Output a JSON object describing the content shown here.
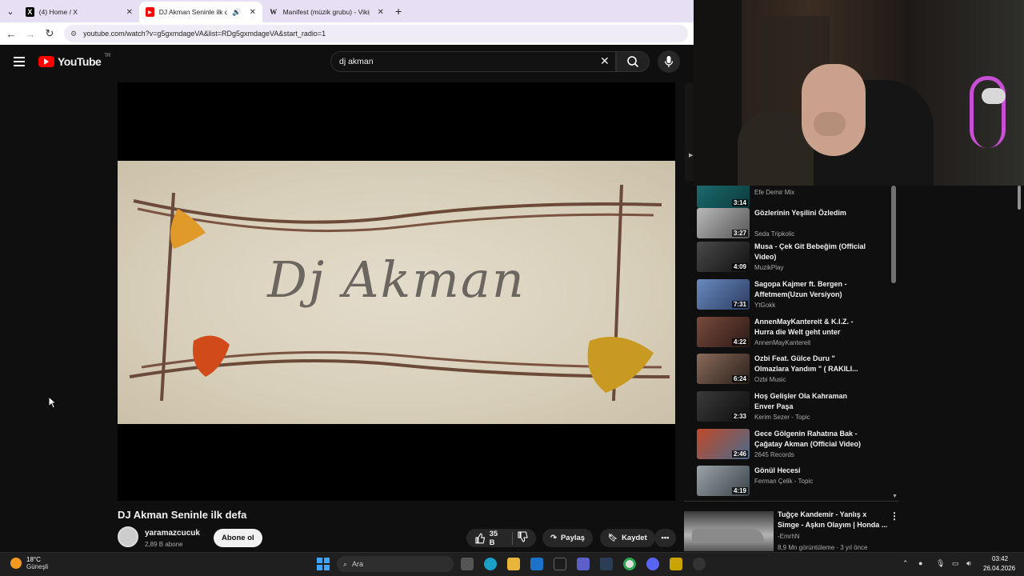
{
  "browser": {
    "tabs": [
      {
        "title": "(4) Home / X",
        "favicon": "X"
      },
      {
        "title": "DJ Akman Seninle ilk defa -",
        "favicon": "yt"
      },
      {
        "title": "Manifest (müzik grubu) - Vikipe",
        "favicon": "W"
      }
    ],
    "url": "youtube.com/watch?v=g5gxmdageVA&list=RDg5gxmdageVA&start_radio=1"
  },
  "youtube": {
    "logo_text": "YouTube",
    "country_code": "TR",
    "search_value": "dj akman"
  },
  "player": {
    "frame_text": "Dj Akman"
  },
  "video": {
    "title": "DJ Akman Seninle ilk defa",
    "channel": "yaramazcucuk",
    "subscribers": "2,89 B abone",
    "subscribe_label": "Abone ol",
    "likes": "35 B",
    "share_label": "Paylaş",
    "save_label": "Kaydet"
  },
  "playlist": [
    {
      "title": "",
      "channel": "Efe Demir Mix",
      "duration": "3:14",
      "colors": [
        "#1f6f72",
        "#0b3a3d"
      ]
    },
    {
      "title": "Gözlerinin Yeşilini Özledim",
      "channel": "Seda Tripkolic",
      "duration": "3:27",
      "colors": [
        "#b9b9b9",
        "#555555"
      ]
    },
    {
      "title": "Musa - Çek Git Bebeğim (Official Video)",
      "channel": "MuzikPlay",
      "duration": "4:09",
      "colors": [
        "#4a4a4a",
        "#111111"
      ]
    },
    {
      "title": "Sagopa Kajmer ft. Bergen - Affetmem(Uzun Versiyon)",
      "channel": "YtGokk",
      "duration": "7:31",
      "colors": [
        "#6a8ac0",
        "#2c3c60"
      ]
    },
    {
      "title": "AnnenMayKantereit & K.I.Z. - Hurra die Welt geht unter",
      "channel": "AnnenMayKantereit",
      "duration": "4:22",
      "colors": [
        "#7a4a3c",
        "#2a1a16"
      ]
    },
    {
      "title": "Ozbi Feat. Gülce Duru \" Olmazlara Yandım \" ( RAKILI...",
      "channel": "Ozbi Music",
      "duration": "6:24",
      "colors": [
        "#8a6a5a",
        "#2a1f1a"
      ]
    },
    {
      "title": "Hoş Gelişler Ola Kahraman Enver Paşa",
      "channel": "Kerim Sezer - Topic",
      "duration": "2:33",
      "colors": [
        "#3a3a3a",
        "#0e0e0e"
      ]
    },
    {
      "title": "Gece Gölgenin Rahatına Bak - Çağatay Akman (Official Video)",
      "channel": "2645 Records",
      "duration": "2:46",
      "colors": [
        "#c04a2a",
        "#4a6a8a"
      ]
    },
    {
      "title": "Gönül Hecesi",
      "channel": "Ferman Çelik - Topic",
      "duration": "4:19",
      "colors": [
        "#9aa4a8",
        "#3a4448"
      ]
    }
  ],
  "next_video": {
    "title": "Tuğçe Kandemir - Yanlış x Simge - Aşkın Olayım | Honda ...",
    "channel": "-EmrhN",
    "meta": "8,9 Mn görüntüleme · 3 yıl önce"
  },
  "taskbar": {
    "temperature": "18°C",
    "weather": "Güneşli",
    "search_placeholder": "Ara",
    "time": "03:42",
    "date": "26.04.2026"
  },
  "colors": {
    "accent": "#ff0000",
    "background": "#0f0f0f",
    "tabbar": "#e7dff4"
  }
}
